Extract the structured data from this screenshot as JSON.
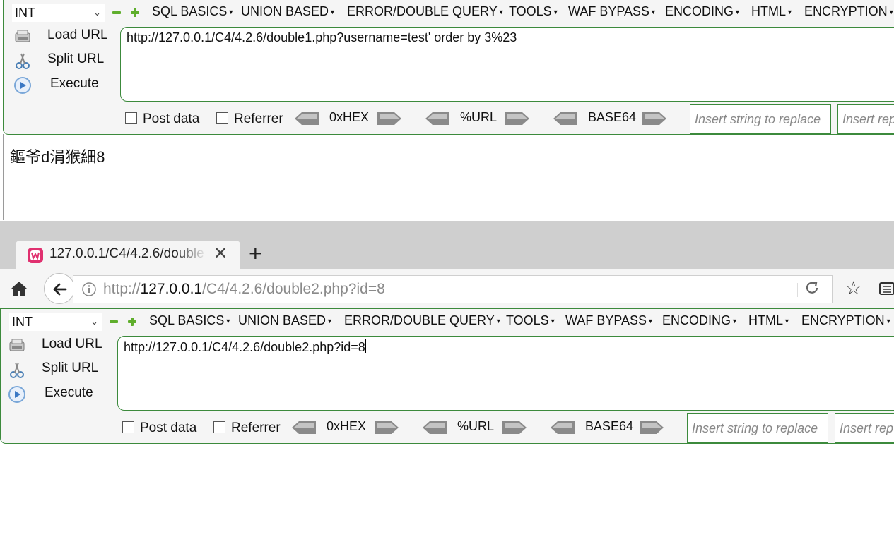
{
  "hackbar_top": {
    "select_value": "INT",
    "menu": [
      "SQL BASICS",
      "UNION BASED",
      "ERROR/DOUBLE QUERY",
      "TOOLS",
      "WAF BYPASS",
      "ENCODING",
      "HTML",
      "ENCRYPTION"
    ],
    "side": {
      "load": "Load URL",
      "split": "Split URL",
      "execute": "Execute"
    },
    "url": "http://127.0.0.1/C4/4.2.6/double1.php?username=test' order by 3%23",
    "post_data": "Post data",
    "referrer": "Referrer",
    "enc": {
      "hex": "0xHEX",
      "url": "%URL",
      "b64": "BASE64"
    },
    "insert_search": "Insert string to replace",
    "insert_replace": "Insert rep"
  },
  "response_text": "鏂爷d涓猴細8",
  "browser": {
    "tab_title": "127.0.0.1/C4/4.2.6/double",
    "url_prefix": "http://",
    "url_host": "127.0.0.1",
    "url_path": "/C4/4.2.6/double2.php?id=8"
  },
  "hackbar_bottom": {
    "select_value": "INT",
    "menu": [
      "SQL BASICS",
      "UNION BASED",
      "ERROR/DOUBLE QUERY",
      "TOOLS",
      "WAF BYPASS",
      "ENCODING",
      "HTML",
      "ENCRYPTION"
    ],
    "side": {
      "load": "Load URL",
      "split": "Split URL",
      "execute": "Execute"
    },
    "url": "http://127.0.0.1/C4/4.2.6/double2.php?id=8",
    "post_data": "Post data",
    "referrer": "Referrer",
    "enc": {
      "hex": "0xHEX",
      "url": "%URL",
      "b64": "BASE64"
    },
    "insert_search": "Insert string to replace",
    "insert_replace": "Insert rep"
  },
  "colors": {
    "accent_green": "#3c8a3c",
    "plus_minus": "#5fae2c",
    "tab_icon": "#e0306f"
  }
}
